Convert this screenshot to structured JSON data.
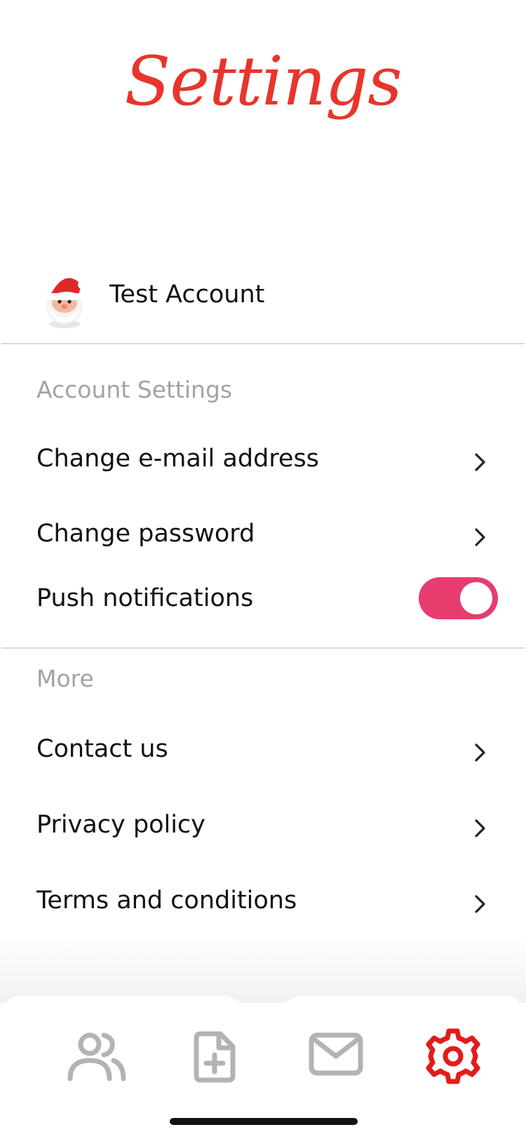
{
  "header": {
    "title": "Settings"
  },
  "profile": {
    "name": "Test Account",
    "avatar_icon": "santa-avatar"
  },
  "account_section": {
    "heading": "Account Settings",
    "items": [
      {
        "label": "Change e-mail address"
      },
      {
        "label": "Change password"
      }
    ],
    "push": {
      "label": "Push notifications",
      "enabled": true
    }
  },
  "more_section": {
    "heading": "More",
    "items": [
      {
        "label": "Contact us"
      },
      {
        "label": "Privacy policy"
      },
      {
        "label": "Terms and conditions"
      }
    ]
  },
  "tabbar": {
    "tabs": [
      {
        "icon": "users-icon",
        "active": false
      },
      {
        "icon": "new-document-icon",
        "active": false
      },
      {
        "icon": "mail-icon",
        "active": false
      },
      {
        "icon": "gear-icon",
        "active": true
      }
    ]
  },
  "colors": {
    "accent": "#e8352b",
    "toggle_on": "#e63d6e",
    "inactive_icon": "#b3b3b3",
    "muted_text": "#a3a3a3"
  }
}
